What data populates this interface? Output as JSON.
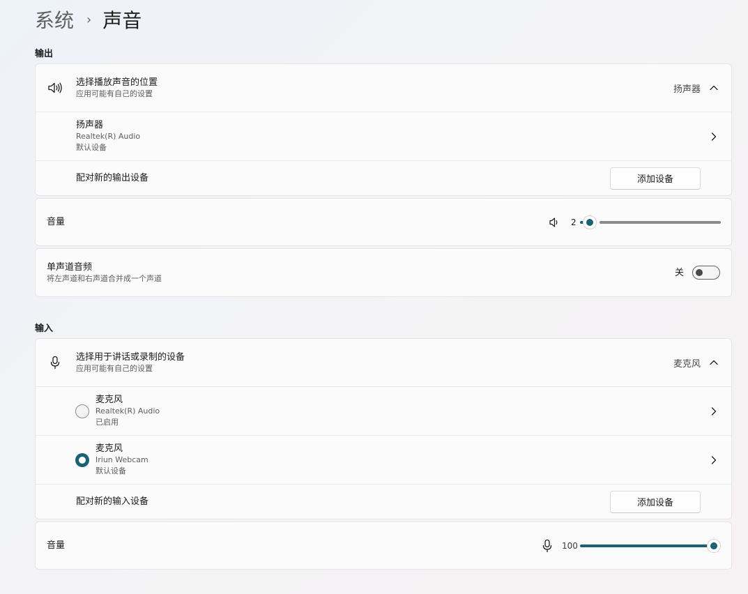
{
  "breadcrumb": {
    "parent": "系统",
    "separator": "›",
    "current": "声音"
  },
  "output": {
    "section_title": "输出",
    "choose": {
      "icon": "speaker-icon",
      "title": "选择播放声音的位置",
      "subtitle": "应用可能有自己的设置",
      "value": "扬声器"
    },
    "device": {
      "name": "扬声器",
      "driver": "Realtek(R) Audio",
      "status": "默认设备"
    },
    "pair": {
      "label": "配对新的输出设备",
      "button": "添加设备"
    },
    "volume": {
      "label": "音量",
      "value": "2",
      "level": 0.02
    },
    "mono": {
      "title": "单声道音频",
      "subtitle": "将左声道和右声道合并成一个声道",
      "state_label": "关",
      "on": false
    }
  },
  "input": {
    "section_title": "输入",
    "choose": {
      "icon": "microphone-icon",
      "title": "选择用于讲话或录制的设备",
      "subtitle": "应用可能有自己的设置",
      "value": "麦克风"
    },
    "devices": [
      {
        "name": "麦克风",
        "driver": "Realtek(R) Audio",
        "status": "已启用",
        "selected": false
      },
      {
        "name": "麦克风",
        "driver": "Iriun Webcam",
        "status": "默认设备",
        "selected": true
      }
    ],
    "pair": {
      "label": "配对新的输入设备",
      "button": "添加设备"
    },
    "volume": {
      "label": "音量",
      "value": "100",
      "level": 1.0
    }
  },
  "colors": {
    "accent": "#1b6174"
  }
}
